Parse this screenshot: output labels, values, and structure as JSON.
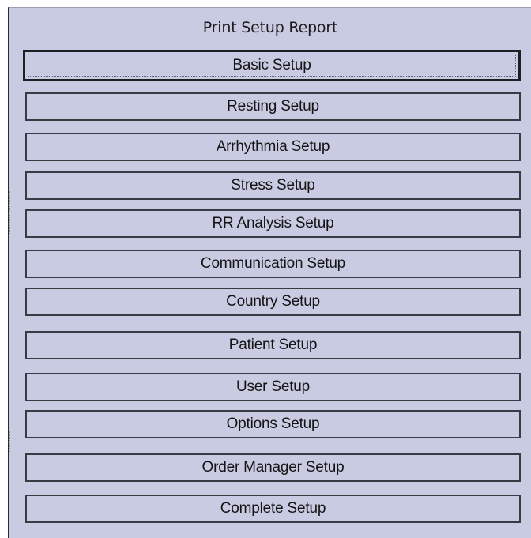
{
  "dialog": {
    "title": "Print Setup Report",
    "selected_index": 0,
    "buttons": [
      "Basic Setup",
      "Resting Setup",
      "Arrhythmia Setup",
      "Stress Setup",
      "RR Analysis Setup",
      "Communication Setup",
      "Country Setup",
      "Patient Setup",
      "User Setup",
      "Options Setup",
      "Order Manager Setup",
      "Complete Setup"
    ]
  },
  "colors": {
    "background": "#c9cbe3",
    "border": "#3a3a44",
    "text": "#141414"
  }
}
